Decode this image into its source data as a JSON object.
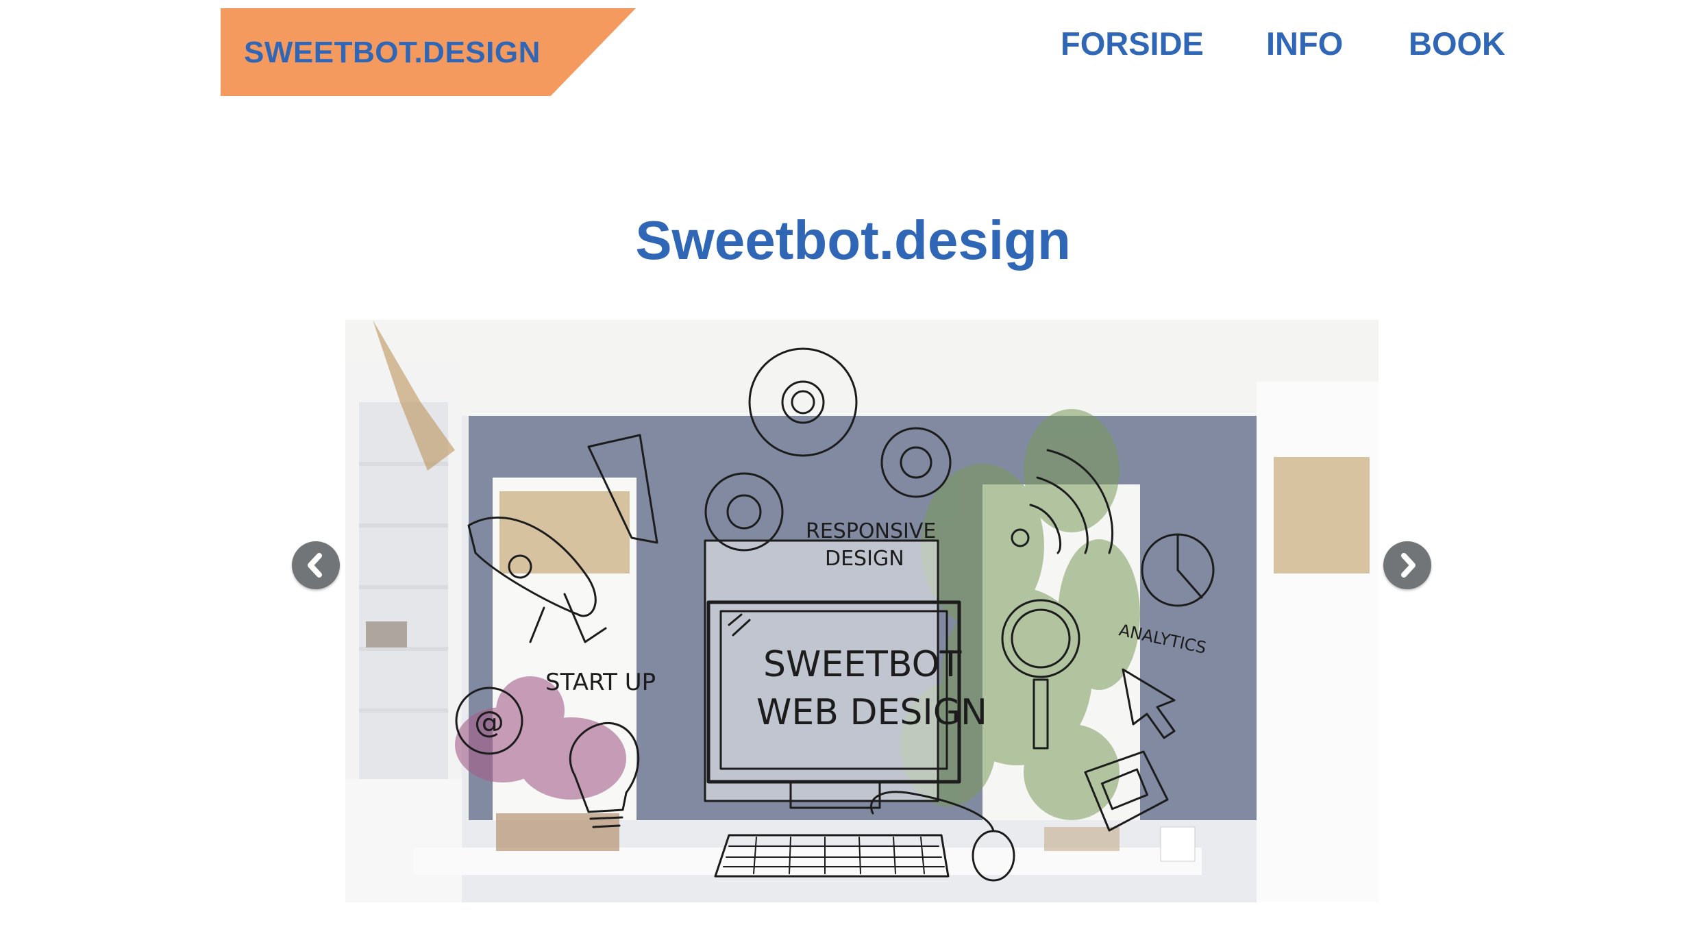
{
  "header": {
    "logo_text": "SWEETBOT.DESIGN",
    "logo_color": "#f59a5f",
    "nav": [
      {
        "label": "FORSIDE"
      },
      {
        "label": "INFO"
      },
      {
        "label": "BOOK"
      }
    ],
    "accent": "#2f67b6"
  },
  "main": {
    "title": "Sweetbot.design"
  },
  "slider": {
    "prev_icon": "chevron-left-icon",
    "next_icon": "chevron-right-icon",
    "slide": {
      "screen_line1": "SWEETBOT",
      "screen_line2": "WEB DESIGN",
      "responsive_line1": "RESPONSIVE",
      "responsive_line2": "DESIGN",
      "analytics": "ANALYTICS",
      "start_up": "START UP",
      "at_symbol": "@"
    }
  }
}
